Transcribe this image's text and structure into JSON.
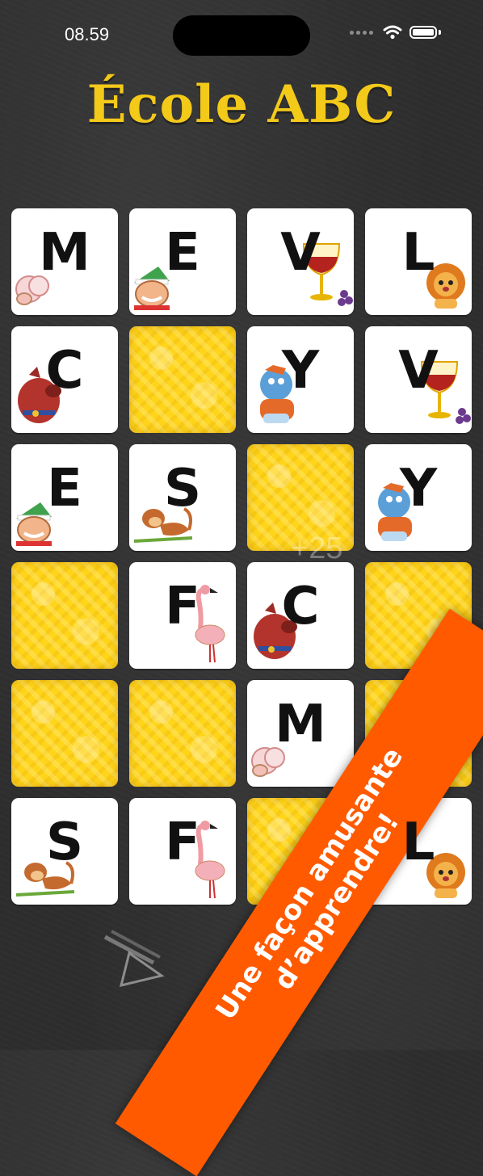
{
  "status": {
    "time": "08.59"
  },
  "app": {
    "title": "École ABC"
  },
  "cards": [
    {
      "letter": "M",
      "picture": "sheep-icon"
    },
    {
      "letter": "E",
      "picture": "elf-icon"
    },
    {
      "letter": "V",
      "picture": "wine-icon"
    },
    {
      "letter": "L",
      "picture": "lion-icon"
    },
    {
      "letter": "C",
      "picture": "dog-icon"
    },
    {
      "letter": "",
      "picture": "card-back"
    },
    {
      "letter": "Y",
      "picture": "yeti-icon"
    },
    {
      "letter": "V",
      "picture": "wine-icon"
    },
    {
      "letter": "E",
      "picture": "elf-icon"
    },
    {
      "letter": "S",
      "picture": "monkey-icon"
    },
    {
      "letter": "",
      "picture": "card-back"
    },
    {
      "letter": "Y",
      "picture": "yeti-icon"
    },
    {
      "letter": "",
      "picture": "card-back"
    },
    {
      "letter": "F",
      "picture": "flamingo-icon"
    },
    {
      "letter": "C",
      "picture": "dog-icon"
    },
    {
      "letter": "",
      "picture": "card-back"
    },
    {
      "letter": "",
      "picture": "card-back"
    },
    {
      "letter": "",
      "picture": "card-back"
    },
    {
      "letter": "M",
      "picture": "sheep-icon"
    },
    {
      "letter": "",
      "picture": "card-back"
    },
    {
      "letter": "S",
      "picture": "monkey-icon"
    },
    {
      "letter": "F",
      "picture": "flamingo-icon"
    },
    {
      "letter": "",
      "picture": "card-back"
    },
    {
      "letter": "L",
      "picture": "lion-icon"
    }
  ],
  "score_popup": "+25",
  "banner": {
    "line1": "Une façon amusante",
    "line2": "d’apprendre!"
  },
  "colors": {
    "title": "#f3c91a",
    "card_back": "#ffd51c",
    "banner": "#ff5a00",
    "board": "#2d2d2d"
  }
}
